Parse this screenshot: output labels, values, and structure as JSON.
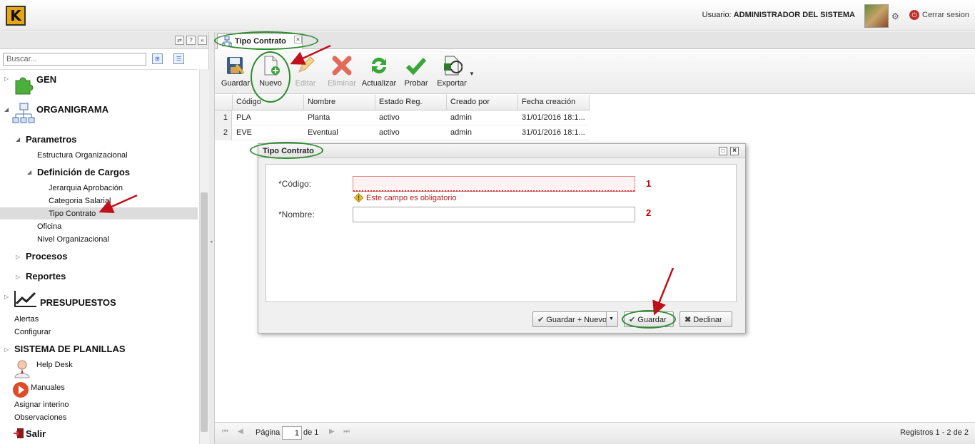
{
  "header": {
    "logo_letter": "K",
    "user_label": "Usuario:",
    "user_name": "ADMINISTRADOR DEL SISTEMA",
    "logout_label": "Cerrar sesion"
  },
  "sidebar": {
    "search_placeholder": "Buscar...",
    "items": [
      {
        "label": "GEN"
      },
      {
        "label": "ORGANIGRAMA"
      },
      {
        "label": "Parametros"
      },
      {
        "label": "Estructura Organizacional"
      },
      {
        "label": "Definición de Cargos"
      },
      {
        "label": "Jerarquia Aprobación"
      },
      {
        "label": "Categoria Salarial"
      },
      {
        "label": "Tipo Contrato"
      },
      {
        "label": "Oficina"
      },
      {
        "label": "Nivel Organizacional"
      },
      {
        "label": "Procesos"
      },
      {
        "label": "Reportes"
      },
      {
        "label": "PRESUPUESTOS"
      },
      {
        "label": "Alertas"
      },
      {
        "label": "Configurar"
      },
      {
        "label": "SISTEMA DE PLANILLAS"
      },
      {
        "label": "Help Desk"
      },
      {
        "label": "Manuales"
      },
      {
        "label": "Asignar interino"
      },
      {
        "label": "Observaciones"
      },
      {
        "label": "Salir"
      }
    ]
  },
  "main": {
    "tab_label": "Tipo Contrato",
    "toolbar": {
      "save": "Guardar",
      "new": "Nuevo",
      "edit": "Editar",
      "delete": "Eliminar",
      "refresh": "Actualizar",
      "test": "Probar",
      "export": "Exportar"
    },
    "grid": {
      "columns": [
        "Código",
        "Nombre",
        "Estado Reg.",
        "Creado por",
        "Fecha creación"
      ],
      "rows": [
        {
          "n": "1",
          "cells": [
            "PLA",
            "Planta",
            "activo",
            "admin",
            "31/01/2016 18:1..."
          ]
        },
        {
          "n": "2",
          "cells": [
            "EVE",
            "Eventual",
            "activo",
            "admin",
            "31/01/2016 18:1..."
          ]
        }
      ]
    },
    "paging": {
      "page_label": "Página",
      "page_value": "1",
      "of_label": "de 1",
      "records": "Registros 1 - 2 de 2"
    }
  },
  "dialog": {
    "title": "Tipo Contrato",
    "code_label": "*Código:",
    "code_error": "Este campo es obligatorio",
    "name_label": "*Nombre:",
    "marker_1": "1",
    "marker_2": "2",
    "btn_save_new": "Guardar + Nuevo",
    "btn_save": "Guardar",
    "btn_decline": "Declinar"
  },
  "colors": {
    "annotation_green": "#2e8b2e",
    "annotation_red": "#c0101a",
    "error_red": "#b02020"
  }
}
